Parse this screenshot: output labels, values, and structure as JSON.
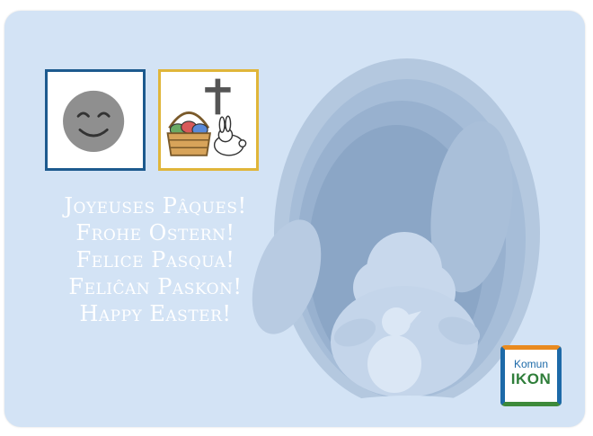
{
  "greetings": [
    "Joyeuses Pâques!",
    "Frohe Ostern!",
    "Felice Pasqua!",
    "Feliĉan Paskon!",
    "Happy Easter!"
  ],
  "logo": {
    "line1": "Komun",
    "line2": "IKON"
  },
  "colors": {
    "background": "#d3e3f5",
    "emotion_tile_border": "#1d5a8e",
    "easter_tile_border": "#e0b63a",
    "text": "#ffffff"
  },
  "icons": [
    "smiley-icon",
    "cross-icon",
    "easter-basket-icon",
    "bunny-icon"
  ]
}
